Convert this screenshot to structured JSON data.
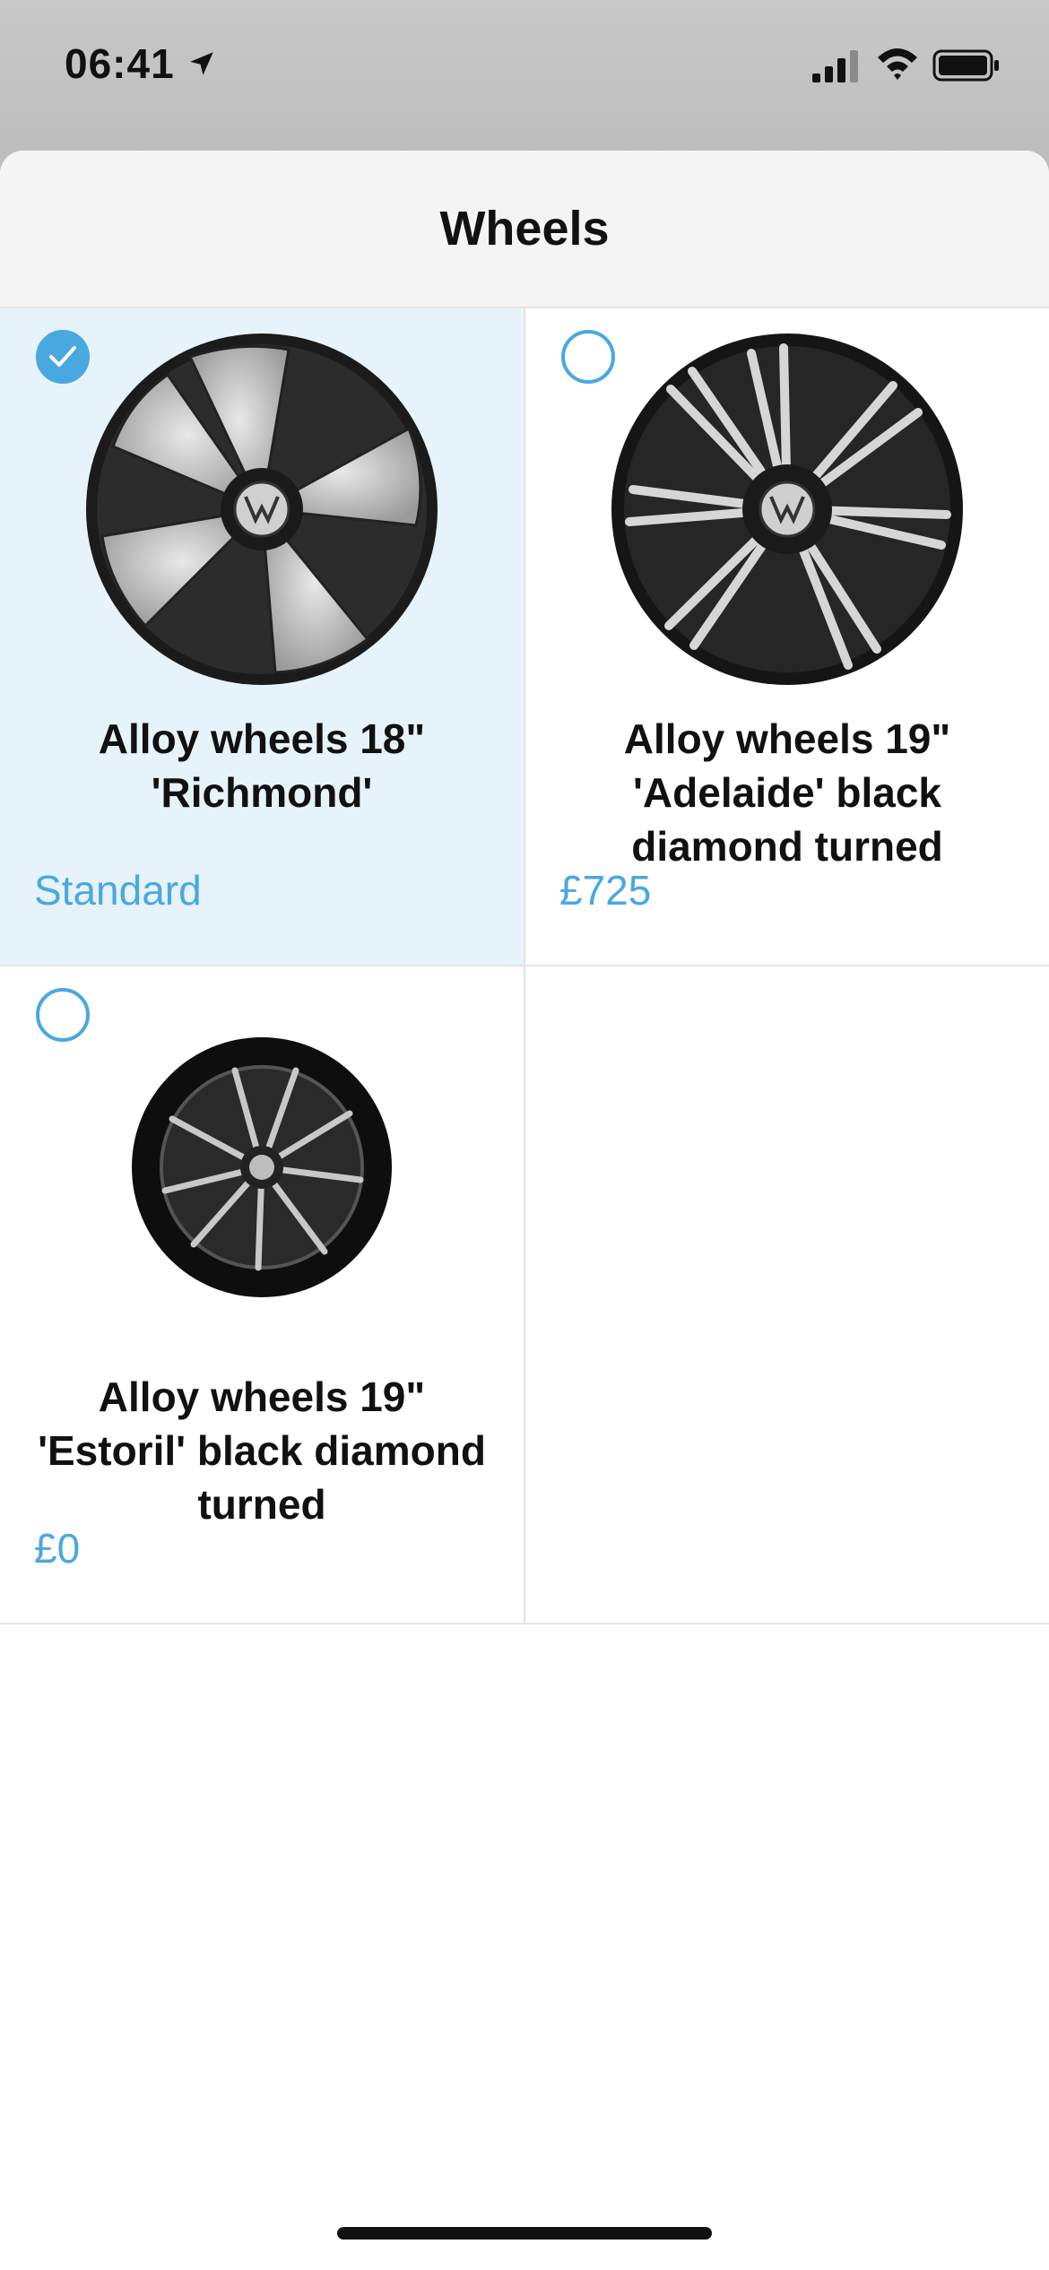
{
  "status_bar": {
    "time": "06:41",
    "icons": [
      "location-arrow-icon",
      "cellular-signal-icon",
      "wifi-icon",
      "battery-icon"
    ]
  },
  "sheet": {
    "title": "Wheels"
  },
  "options": [
    {
      "title": "Alloy wheels 18\" 'Richmond'",
      "price": "Standard",
      "selected": true,
      "icon": "richmond-wheel-image"
    },
    {
      "title": "Alloy wheels 19\" 'Adelaide' black diamond turned",
      "price": "£725",
      "selected": false,
      "icon": "adelaide-wheel-image"
    },
    {
      "title": "Alloy wheels 19\" 'Estoril' black diamond turned",
      "price": "£0",
      "selected": false,
      "icon": "estoril-wheel-image"
    }
  ],
  "colors": {
    "accent": "#4aa8e0",
    "selected_background": "#e6f3fb",
    "header_background": "#f4f4f4"
  }
}
